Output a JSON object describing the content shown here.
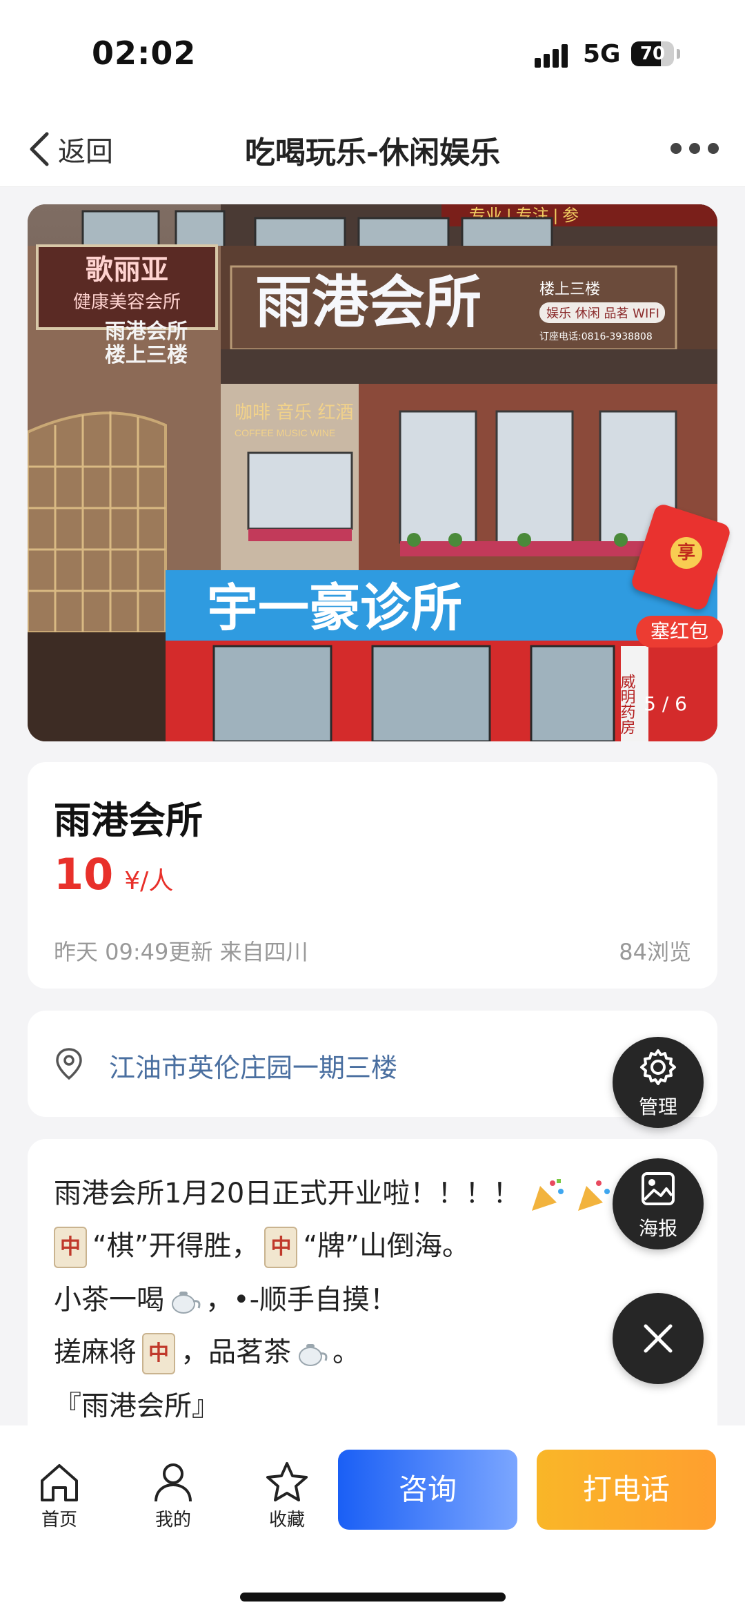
{
  "status_bar": {
    "time": "02:02",
    "network": "5G",
    "battery": "70",
    "battery_level": 0.7
  },
  "nav": {
    "back_label": "返回",
    "title": "吃喝玩乐-休闲娱乐",
    "more_icon": "more-dots-icon"
  },
  "hero": {
    "pager": "5 / 6",
    "signs": {
      "main": "雨港会所",
      "main_floor": "楼上三楼",
      "main_tags": "娱乐 休闲 品茗 WIFI",
      "main_phone": "订座电话:0816-3938808",
      "clinic": "宇一豪诊所",
      "coffee": "咖啡  音乐  红酒",
      "coffee_en": "COFFEE  MUSIC  WINE",
      "beauty": "歌丽亚",
      "beauty_sub": "健康美容会所",
      "left_sign_1": "雨港会所",
      "left_sign_2": "楼上三楼",
      "top_sign": "专业 | 专注 | 参",
      "pharmacy": "威明药房"
    },
    "red_packet": {
      "coin": "享",
      "label": "塞红包"
    }
  },
  "info": {
    "name": "雨港会所",
    "price": "10",
    "price_unit": "¥/人",
    "meta": "昨天 09:49更新 来自四川",
    "views": "84浏览"
  },
  "address": {
    "text": "江油市英伦庄园一期三楼"
  },
  "description": {
    "line1": "雨港会所1月20日正式开业啦！！！！",
    "line2_a": "“棋”开得胜，",
    "line2_b": "“牌”山倒海。",
    "line3_a": "小茶一喝",
    "line3_b": "，•-顺手自摸！",
    "line4_a": "搓麻将",
    "line4_b": "，品茗茶",
    "line4_c": "。",
    "line5": "『雨港会所』",
    "tile_char": "中"
  },
  "fabs": {
    "manage": "管理",
    "poster": "海报"
  },
  "tabbar": {
    "home": "首页",
    "mine": "我的",
    "favorite": "收藏",
    "consult": "咨询",
    "call": "打电话"
  },
  "colors": {
    "accent_red": "#e8302a",
    "consult_blue": "#1a5ff5",
    "call_orange": "#f9b628",
    "address_blue": "#4a6fa0"
  }
}
